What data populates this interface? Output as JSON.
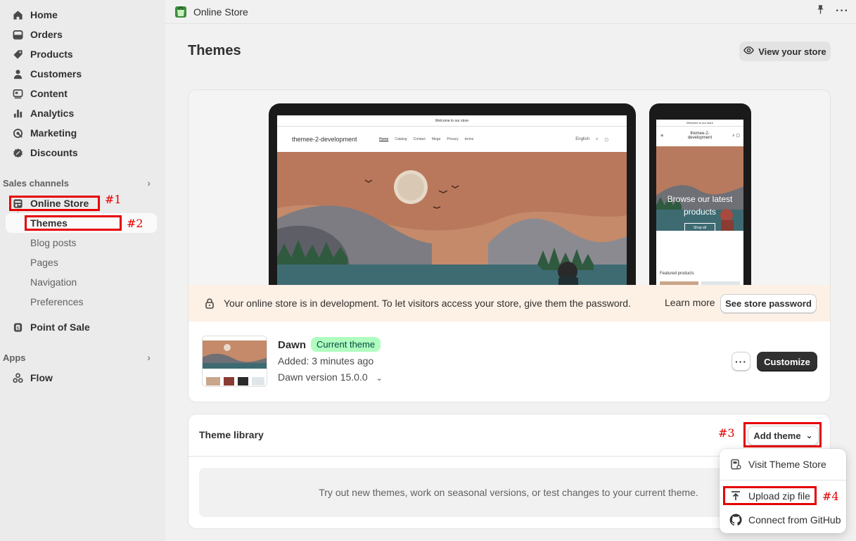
{
  "sidebar": {
    "items": [
      {
        "label": "Home",
        "icon": "home-icon"
      },
      {
        "label": "Orders",
        "icon": "orders-icon"
      },
      {
        "label": "Products",
        "icon": "products-tag-icon"
      },
      {
        "label": "Customers",
        "icon": "customers-icon"
      },
      {
        "label": "Content",
        "icon": "content-icon"
      },
      {
        "label": "Analytics",
        "icon": "analytics-icon"
      },
      {
        "label": "Marketing",
        "icon": "marketing-icon"
      },
      {
        "label": "Discounts",
        "icon": "discounts-icon"
      }
    ],
    "sales_channels_label": "Sales channels",
    "online_store_label": "Online Store",
    "online_store_sub": [
      "Themes",
      "Blog posts",
      "Pages",
      "Navigation",
      "Preferences"
    ],
    "point_of_sale_label": "Point of Sale",
    "apps_label": "Apps",
    "flow_label": "Flow"
  },
  "annotations": [
    "#1",
    "#2",
    "#3",
    "#4"
  ],
  "topbar": {
    "title": "Online Store"
  },
  "main": {
    "page_title": "Themes",
    "view_store_label": "View your store"
  },
  "preview": {
    "laptop_banner": "Welcome to our store",
    "laptop_store_name": "themee-2-development",
    "laptop_nav_links": [
      "Home",
      "Catalog",
      "Contact",
      "Mega",
      "Privacy",
      "terms"
    ],
    "laptop_lang": "English",
    "phone_banner": "Welcome to our store",
    "phone_store_name": "themee-2-development",
    "phone_hero_text": "Browse our latest products",
    "phone_shop_all": "Shop all",
    "phone_featured": "Featured products"
  },
  "dev_banner": {
    "message": "Your online store is in development. To let visitors access your store, give them the password.",
    "learn_more": "Learn more",
    "see_password": "See store password"
  },
  "current_theme": {
    "name": "Dawn",
    "badge": "Current theme",
    "added": "Added: 3 minutes ago",
    "version": "Dawn version 15.0.0",
    "customize_label": "Customize"
  },
  "library": {
    "title": "Theme library",
    "add_theme_label": "Add theme",
    "empty_text": "Try out new themes, work on seasonal versions, or test changes to your current theme.",
    "menu": [
      "Visit Theme Store",
      "Upload zip file",
      "Connect from GitHub"
    ]
  },
  "colors": {
    "annotation": "#e60000",
    "badge_bg": "#affebf",
    "banner_bg": "#fdf0e5",
    "primary_btn": "#303030"
  }
}
